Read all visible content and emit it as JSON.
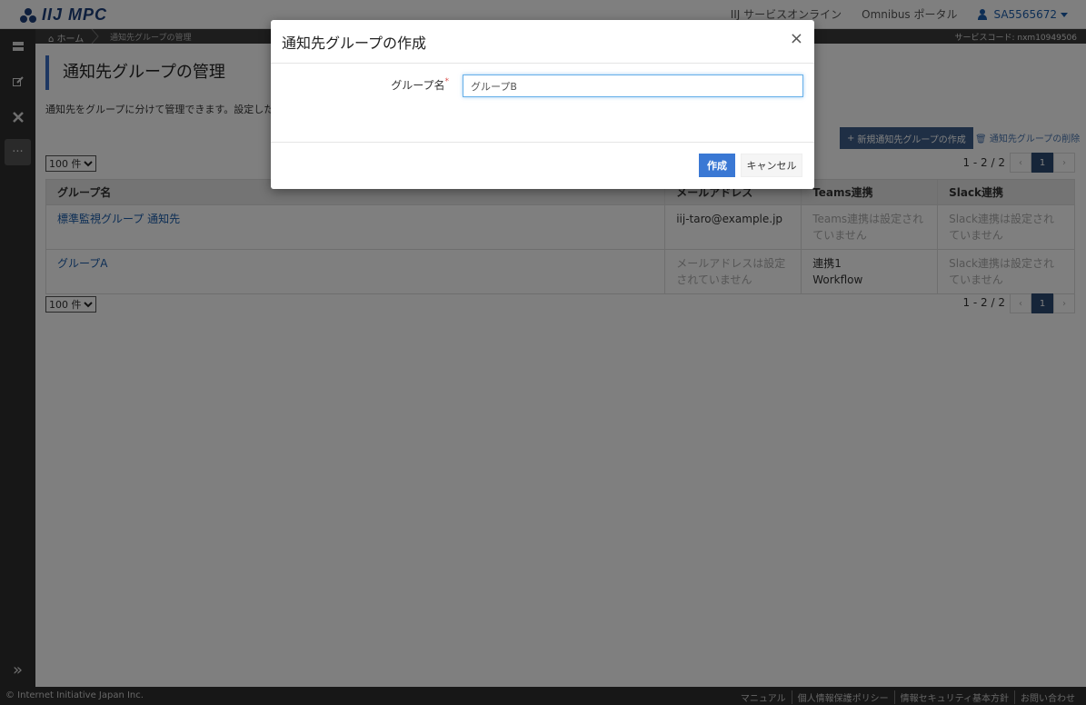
{
  "header": {
    "logo_text": "IIJ MPC",
    "links": [
      "IIJ サービスオンライン",
      "Omnibus ポータル"
    ],
    "user": "SA5565672"
  },
  "sidebar": {
    "icons": [
      "server-icon",
      "edit-icon",
      "tools-icon",
      "more-icon",
      "expand-icon"
    ]
  },
  "breadcrumb": {
    "home": "ホーム",
    "current": "通知先グループの管理",
    "service_code": "サービスコード: nxm10949506"
  },
  "page": {
    "title": "通知先グループの管理",
    "description": "通知先をグループに分けて管理できます。設定した通",
    "new_button": "新規通知先グループの作成",
    "delete_link": "通知先グループの削除",
    "per_page": "100 件",
    "pager_text": "1 - 2 / 2",
    "pager_current": "1",
    "pager_prev": "‹",
    "pager_next": "›"
  },
  "table": {
    "headers": [
      "グループ名",
      "メールアドレス",
      "Teams連携",
      "Slack連携"
    ],
    "rows": [
      {
        "name": "標準監視グループ 通知先",
        "email": "iij-taro@example.jp",
        "teams": "Teams連携は設定されていません",
        "slack": "Slack連携は設定されていません"
      },
      {
        "name": "グループA",
        "email": "メールアドレスは設定されていません",
        "teams_line1": "連携1",
        "teams_line2": "Workflow",
        "slack": "Slack連携は設定されていません"
      }
    ]
  },
  "footer": {
    "copyright": "© Internet Initiative Japan Inc.",
    "links": [
      "マニュアル",
      "個人情報保護ポリシー",
      "情報セキュリティ基本方針",
      "お問い合わせ"
    ]
  },
  "modal": {
    "title": "通知先グループの作成",
    "close": "×",
    "field_label": "グループ名",
    "required_mark": "*",
    "field_value": "グループB",
    "create_button": "作成",
    "cancel_button": "キャンセル"
  }
}
